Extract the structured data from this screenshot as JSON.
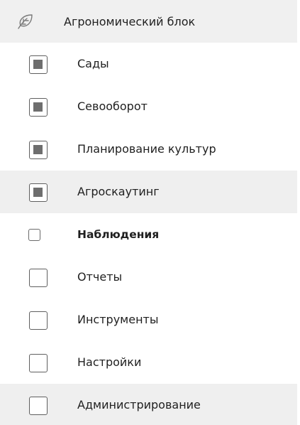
{
  "header": {
    "icon": "leaf-icon",
    "label": "Агрономический блок"
  },
  "items": [
    {
      "label": "Сады",
      "checked": true
    },
    {
      "label": "Севооборот",
      "checked": true
    },
    {
      "label": "Планирование культур",
      "checked": true
    },
    {
      "label": "Агроскаутинг",
      "checked": true,
      "highlighted": true
    },
    {
      "label": "Наблюдения",
      "checked": false,
      "focused": true
    },
    {
      "label": "Отчеты",
      "checked": false
    },
    {
      "label": "Инструменты",
      "checked": false
    },
    {
      "label": "Настройки",
      "checked": false
    },
    {
      "label": "Администрирование",
      "checked": false,
      "highlighted": true
    }
  ],
  "colors": {
    "header_bg": "#f0f0f0",
    "highlight_bg": "#efefef",
    "checkbox_fill": "#6e6e6e",
    "checkbox_border": "#5f5f5f",
    "text": "#1f1f1f"
  }
}
